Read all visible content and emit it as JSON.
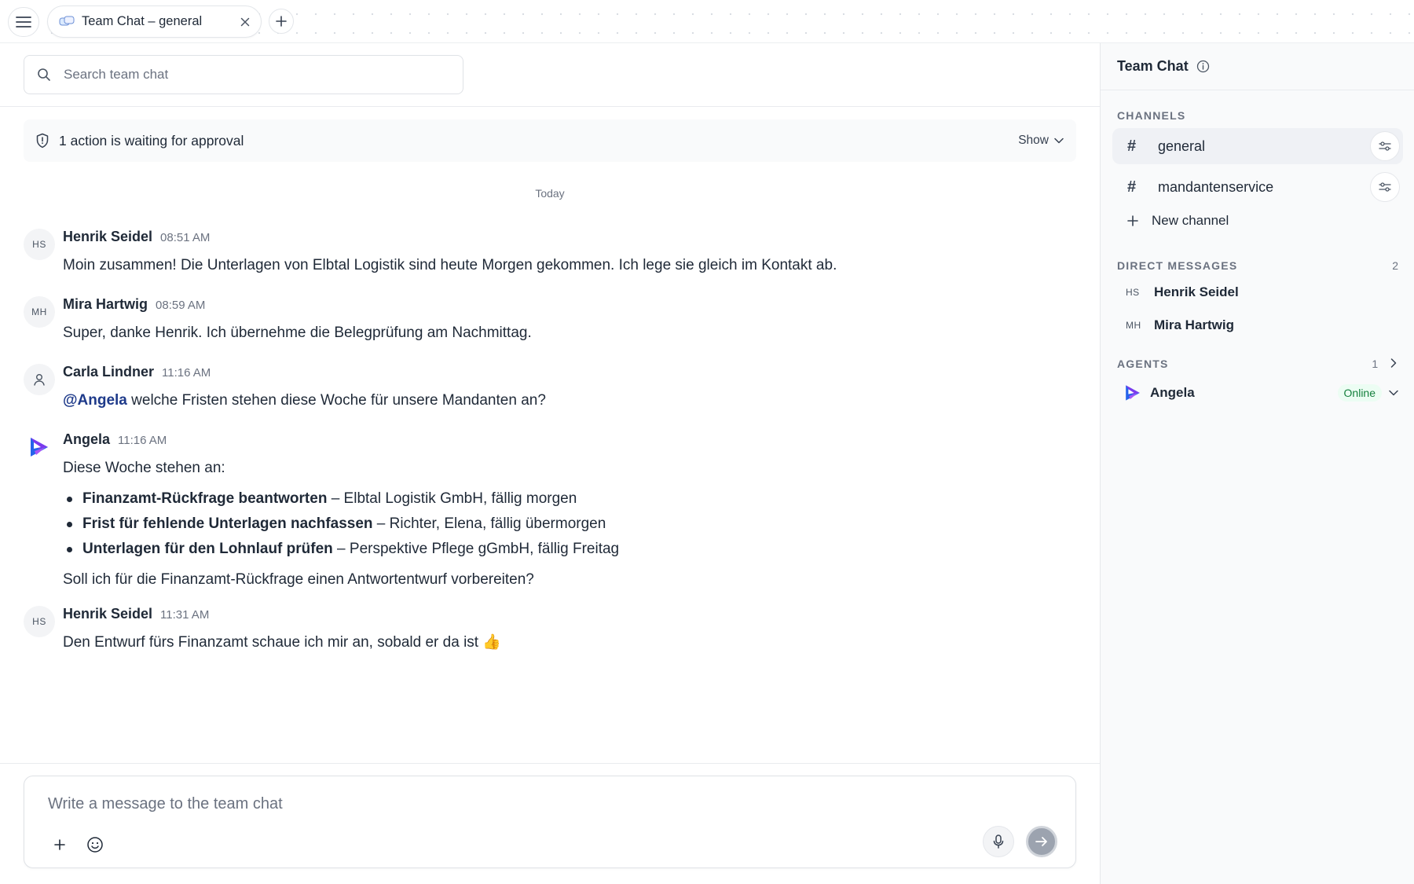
{
  "tabbar": {
    "tab_label": "Team Chat – general"
  },
  "search": {
    "placeholder": "Search team chat"
  },
  "approval": {
    "text": "1 action is waiting for approval",
    "show_label": "Show"
  },
  "date_separator": "Today",
  "messages": [
    {
      "initials": "HS",
      "author": "Henrik Seidel",
      "time": "08:51 AM",
      "text": "Moin zusammen! Die Unterlagen von Elbtal Logistik sind heute Morgen gekommen. Ich lege sie gleich im Kontakt ab."
    },
    {
      "initials": "MH",
      "author": "Mira Hartwig",
      "time": "08:59 AM",
      "text": "Super, danke Henrik. Ich übernehme die Belegprüfung am Nachmittag."
    },
    {
      "author": "Carla Lindner",
      "time": "11:16 AM",
      "mention": "@Angela",
      "text": " welche Fristen stehen diese Woche für unsere Mandanten an?"
    },
    {
      "author": "Angela",
      "time": "11:16 AM",
      "intro": "Diese Woche stehen an:",
      "items": [
        {
          "title": "Finanzamt-Rückfrage beantworten",
          "detail": " – Elbtal Logistik GmbH, fällig morgen"
        },
        {
          "title": "Frist für fehlende Unterlagen nachfassen",
          "detail": " – Richter, Elena, fällig übermorgen"
        },
        {
          "title": "Unterlagen für den Lohnlauf prüfen",
          "detail": " – Perspektive Pflege gGmbH, fällig Freitag"
        }
      ],
      "followup": "Soll ich für die Finanzamt-Rückfrage einen Antwortentwurf vorbereiten?"
    },
    {
      "initials": "HS",
      "author": "Henrik Seidel",
      "time": "11:31 AM",
      "text": "Den Entwurf fürs Finanzamt schaue ich mir an, sobald er da ist 👍"
    }
  ],
  "composer": {
    "placeholder": "Write a message to the team chat"
  },
  "sidebar": {
    "title": "Team Chat",
    "channels_label": "CHANNELS",
    "channels": [
      {
        "name": "general",
        "active": true
      },
      {
        "name": "mandantenservice",
        "active": false
      }
    ],
    "new_channel_label": "New channel",
    "dm_label": "DIRECT MESSAGES",
    "dm_count": "2",
    "direct_messages": [
      {
        "initials": "HS",
        "name": "Henrik Seidel"
      },
      {
        "initials": "MH",
        "name": "Mira Hartwig"
      }
    ],
    "agents_label": "AGENTS",
    "agents_count": "1",
    "agents": [
      {
        "name": "Angela",
        "status": "Online"
      }
    ]
  },
  "colors": {
    "mention": "#1e3a8a",
    "online_bg": "#ecfdf3",
    "online_text": "#15803d",
    "brand_blue": "#2563eb",
    "brand_purple": "#7c3aed"
  }
}
